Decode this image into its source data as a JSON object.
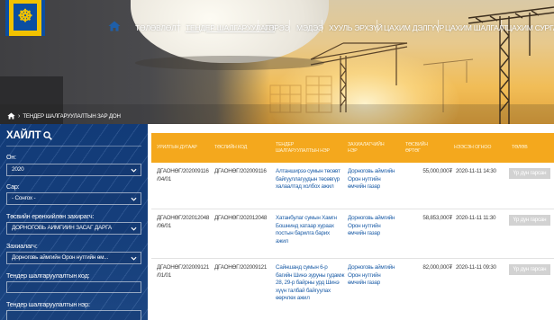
{
  "nav": {
    "items": [
      {
        "label": "ТӨЛӨВЛӨЛТ",
        "active": false
      },
      {
        "label": "ТЕНДЕР ШАЛГАРУУЛАЛТ",
        "active": true
      },
      {
        "label": "ГЭРЭЭ",
        "active": false
      },
      {
        "label": "МЭДЭЭ",
        "active": false
      },
      {
        "label": "ХУУЛЬ ЭРХЗҮЙ",
        "active": false
      },
      {
        "label": "ЦАХИМ ДЭЛГҮҮР",
        "active": false
      },
      {
        "label": "ЦАХИМ ШАЛГАЛТ",
        "active": false
      },
      {
        "label": "ЦАХИМ СУРГАЛТ",
        "active": false
      }
    ]
  },
  "breadcrumb": {
    "current": "ТЕНДЕР ШАЛГАРУУЛАЛТЫН ЗАР ДОН"
  },
  "search": {
    "title": "ХАЙЛТ",
    "year_label": "Он:",
    "year_value": "2020",
    "month_label": "Сар:",
    "month_value": "- Сонгох -",
    "buyer_label": "Төсвийн ерөнхийлөн захирагч:",
    "buyer_value": "ДОРНОГОВЬ АЙМГИЙН ЗАСАГ ДАРГА",
    "client_label": "Захиалагч:",
    "client_value": "Дорноговь аймгийн Орон нутгийн өм...",
    "code_label": "Тендер шалгаруулалтын код:",
    "code_value": "",
    "name_label": "Тендер шалгаруулалтын нэр:",
    "name_value": ""
  },
  "table": {
    "headers": {
      "col1": "УРИЛГЫН ДУГААР",
      "col2": "ТӨСЛИЙН КОД",
      "col3_line1": "ТЕНДЕР",
      "col3_line2": "ШАЛГАРУУЛАЛТЫН НЭР",
      "col4_line1": "ЗАХИАЛАГЧИЙН",
      "col4_line2": "НЭР",
      "col5_line1": "ТӨСВИЙН",
      "col5_line2": "ӨРТӨГ",
      "col6": "НЭЭСЭН ОГНОО",
      "col7": "ТӨЛӨВ"
    },
    "rows": [
      {
        "invite_1": "ДГАОНӨГ/202009116",
        "invite_2": "/04/01",
        "code": "ДГАОНӨГ/202009116",
        "name_1": "Алтанширээ сумын төсөвт",
        "name_2": "байгууллагуудын төсөвгүр",
        "name_3": "халаалтад холбох ажил",
        "client_1": "Дорноговь аймгийн",
        "client_2": "Орон нутгийн",
        "client_3": "өмчийн газар",
        "budget": "55,000,000₮",
        "date": "2020-11-11 14:30",
        "status": "Үр дүн гарсан"
      },
      {
        "invite_1": "ДГАОНӨГ/202012048",
        "invite_2": "/06/01",
        "code": "ДГАОНӨГ/202012048",
        "name_1": "Хатанбулаг сумын Хамгн",
        "name_2": "Бошнинд хатаар хураах",
        "name_3": "постын барилга барих",
        "name_4": "ажил",
        "client_1": "Дорноговь аймгийн",
        "client_2": "Орон нутгийн",
        "client_3": "өмчийн газар",
        "budget": "58,853,000₮",
        "date": "2020-11-11 11:30",
        "status": "Үр дүн гарсан"
      },
      {
        "invite_1": "ДГАОНӨГ/202009121",
        "invite_2": "/01/01",
        "code": "ДГАОНӨГ/202009121",
        "name_1": "Сайншанд сумын 6-р",
        "name_2": "багийн Шинэ зуруны гудамж",
        "name_3": "28, 29-р байрны урд Шинэ",
        "name_4": "хүүн талбай байгуулах",
        "name_5": "өөрчлөх ажил",
        "client_1": "Дорноговь аймгийн",
        "client_2": "Орон нутгийн",
        "client_3": "өмчийн газар",
        "budget": "82,000,000₮",
        "date": "2020-11-11 09:30",
        "status": "Үр дүн гарсан"
      }
    ]
  }
}
